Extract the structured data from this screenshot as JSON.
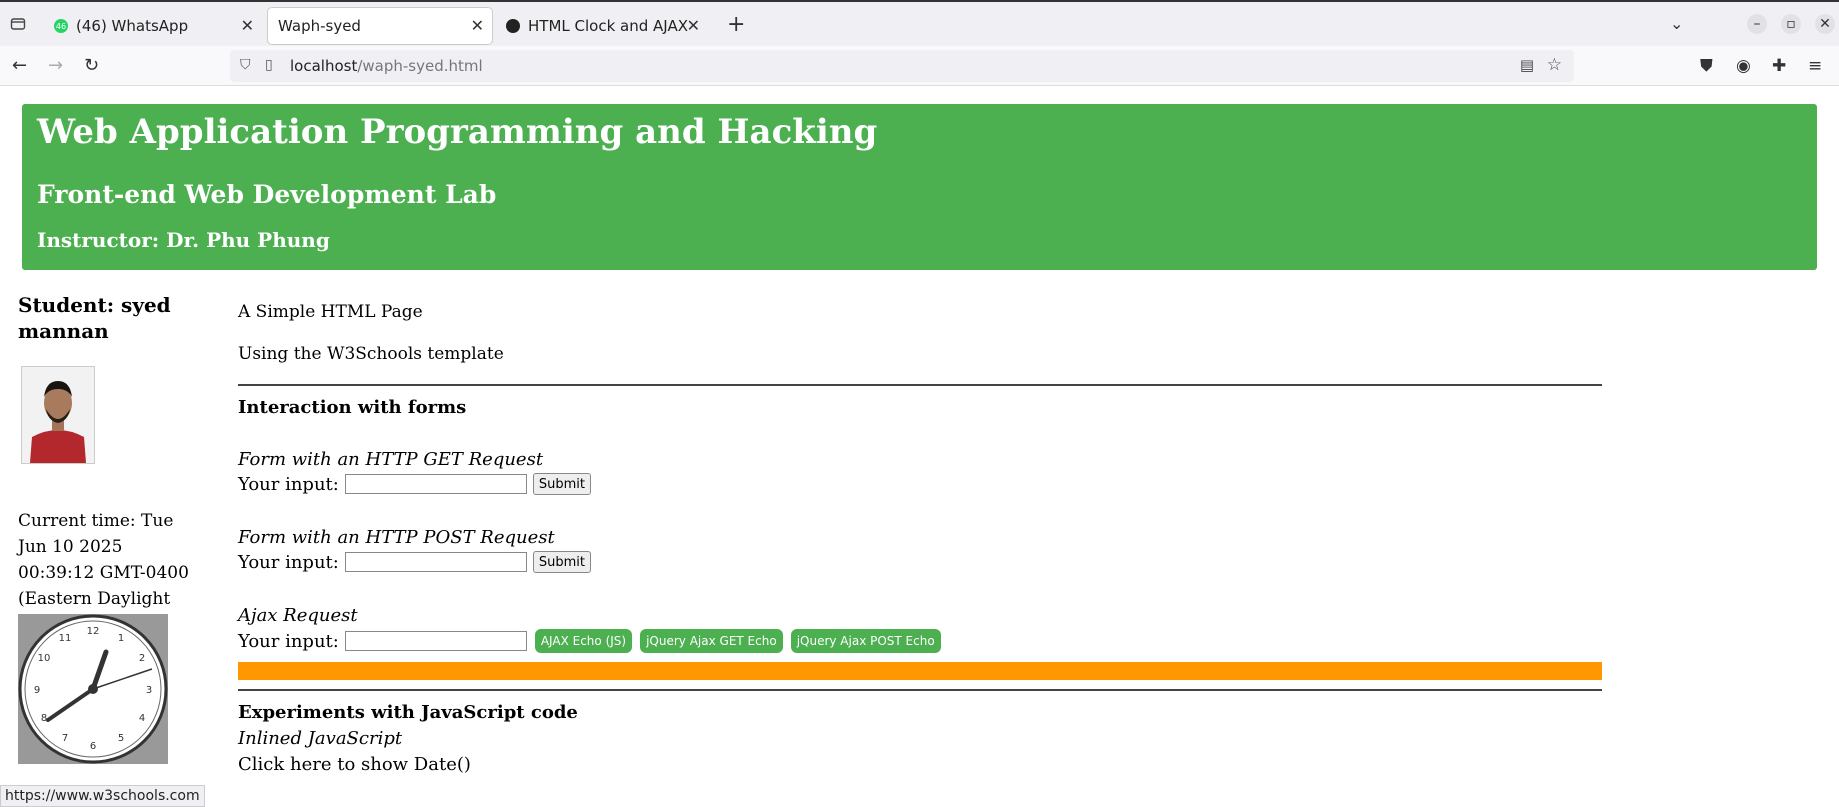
{
  "browser": {
    "tabs": [
      {
        "label": "(46) WhatsApp",
        "badge": "46",
        "active": false
      },
      {
        "label": "Waph-syed",
        "active": true
      },
      {
        "label": "HTML Clock and AJAX",
        "active": false
      }
    ],
    "url_host": "localhost",
    "url_path": "/waph-syed.html",
    "status_url": "https://www.w3schools.com"
  },
  "header": {
    "title": "Web Application Programming and Hacking",
    "subtitle": "Front-end Web Development Lab",
    "instructor": "Instructor: Dr. Phu Phung",
    "color": "#4caf50"
  },
  "sidebar": {
    "student": "Student: syed mannan",
    "current_time": "Current time: Tue Jun 10 2025 00:39:12 GMT-0400 (Eastern Daylight Time)",
    "clock_numbers": [
      "12",
      "1",
      "2",
      "3",
      "4",
      "5",
      "6",
      "7",
      "8",
      "9",
      "10",
      "11"
    ]
  },
  "main": {
    "p1": "A Simple HTML Page",
    "p2": "Using the W3Schools template",
    "section_forms": "Interaction with forms",
    "get_label": "Form with an HTTP GET Request",
    "post_label": "Form with an HTTP POST Request",
    "ajax_label": "Ajax Request",
    "input_label": "Your input:",
    "submit_label": "Submit",
    "ajax_btn_js": "AJAX Echo (JS)",
    "ajax_btn_get": "jQuery Ajax GET Echo",
    "ajax_btn_post": "jQuery Ajax POST Echo",
    "section_js": "Experiments with JavaScript code",
    "inlined_label": "Inlined JavaScript",
    "show_date": "Click here to show Date()",
    "accent_orange": "#ff9800"
  }
}
